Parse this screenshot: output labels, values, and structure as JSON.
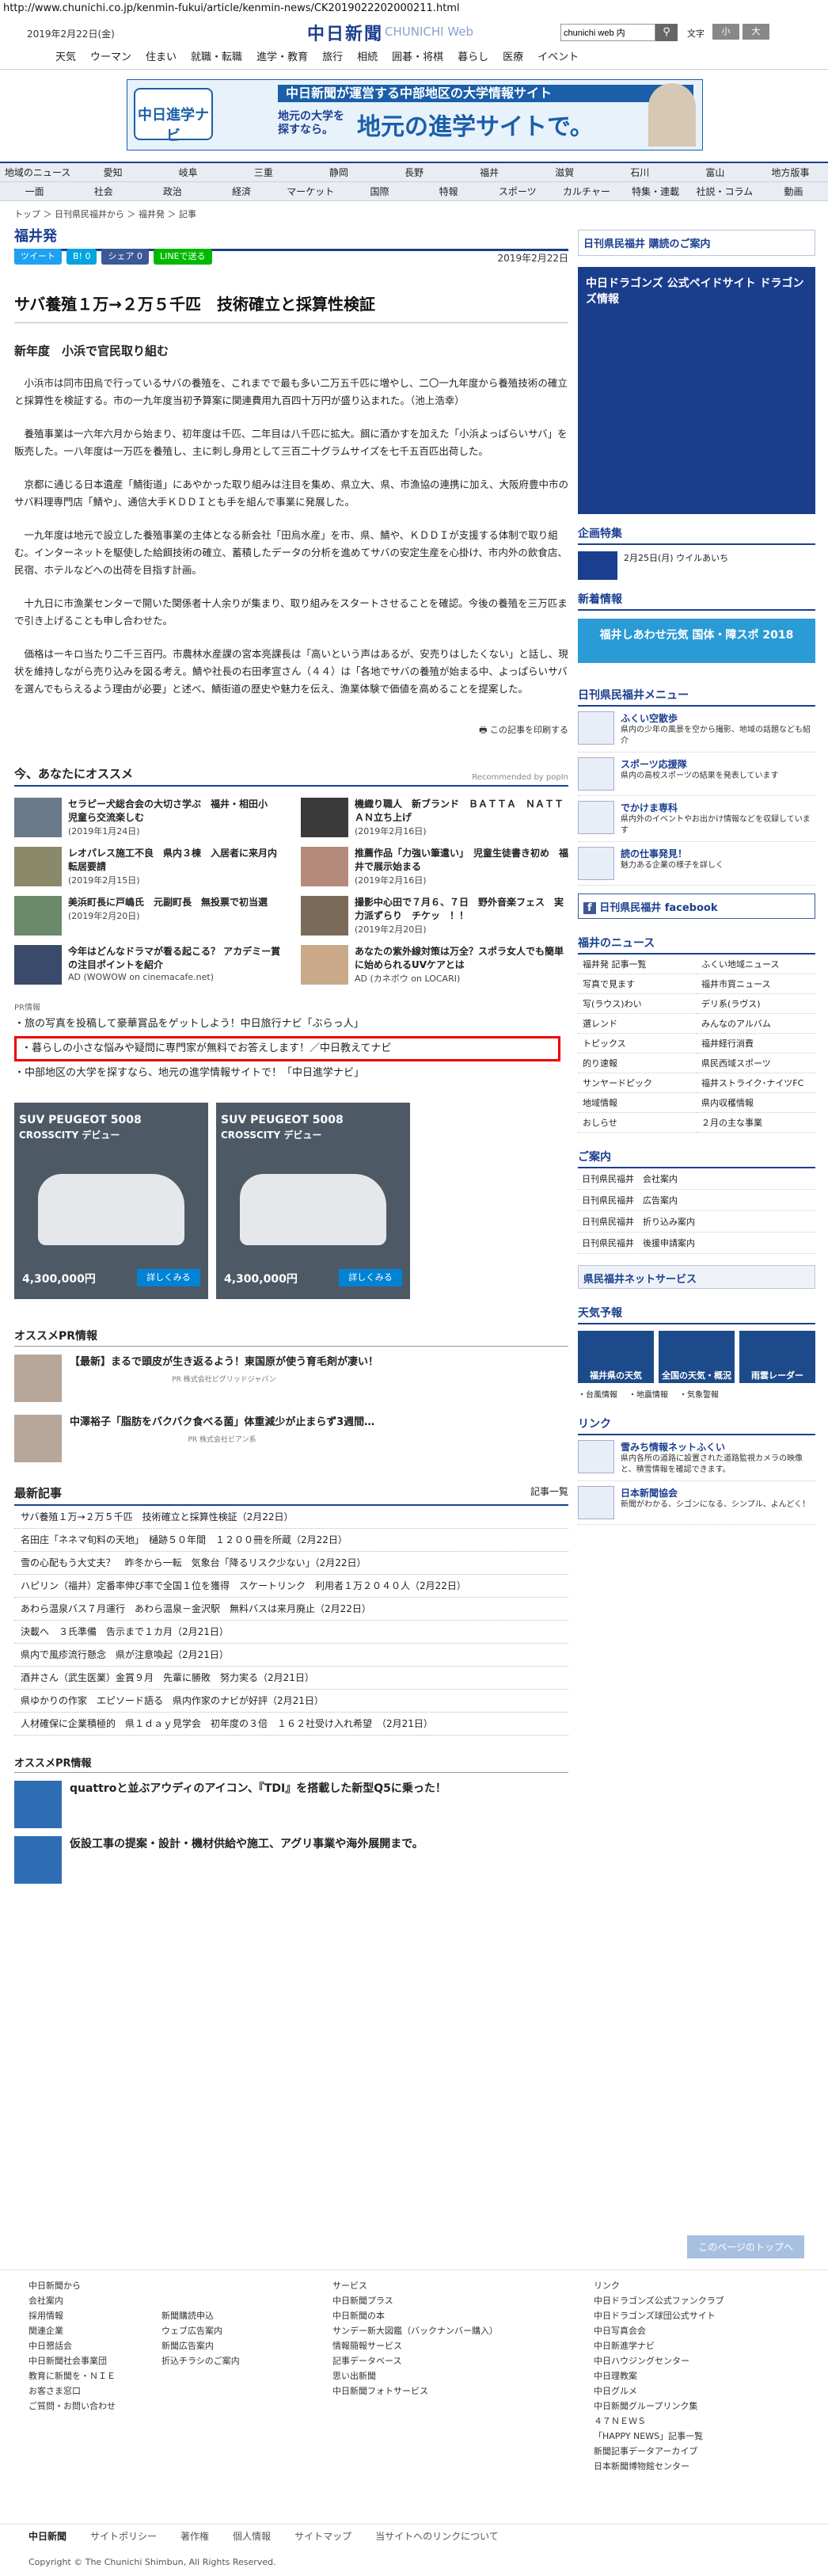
{
  "url": "http://www.chunichi.co.jp/kenmin-fukui/article/kenmin-news/CK2019022202000211.html",
  "header": {
    "date": "2019年2月22日(金)",
    "logo": "中日新聞",
    "logo_en": "CHUNICHI Web",
    "search_placeholder": "chunichi web 内",
    "font_label": "文字",
    "font_small": "小",
    "font_large": "大"
  },
  "top_nav": [
    "天気",
    "ウーマン",
    "住まい",
    "就職・転職",
    "進学・教育",
    "旅行",
    "相続",
    "囲碁・将棋",
    "暮らし",
    "医療",
    "イベント"
  ],
  "banner": {
    "top": "中日新聞が運営する中部地区の大学情報サイト",
    "logo": "中日進学ナビ",
    "sub": "地元の大学を探すなら。",
    "main": "地元の進学サイトで。"
  },
  "sec_nav_1": [
    "地域のニュース",
    "愛知",
    "岐阜",
    "三重",
    "静岡",
    "長野",
    "福井",
    "滋賀",
    "石川",
    "富山",
    "地方版事"
  ],
  "sec_nav_2": [
    "一面",
    "社会",
    "政治",
    "経済",
    "マーケット",
    "国際",
    "特報",
    "スポーツ",
    "カルチャー",
    "特集・連載",
    "社説・コラム",
    "動画"
  ],
  "breadcrumb": "トップ ＞ 日刊県民福井から ＞ 福井発 ＞ 記事",
  "section_title": "福井発",
  "share": [
    "ツイート",
    "B! 0",
    "シェア 0",
    "LINEで送る"
  ],
  "pub_date": "2019年2月22日",
  "headline": "サバ養殖１万→２万５千匹　技術確立と採算性検証",
  "subhead": "新年度　小浜で官民取り組む",
  "paragraphs": [
    "小浜市は同市田烏で行っているサバの養殖を、これまでで最も多い二万五千匹に増やし、二〇一九年度から養殖技術の確立と採算性を検証する。市の一九年度当初予算案に関連費用九百四十万円が盛り込まれた。（池上浩幸）",
    "養殖事業は一六年六月から始まり、初年度は千匹、二年目は八千匹に拡大。餌に酒かすを加えた「小浜よっぱらいサバ」を販売した。一八年度は一万匹を養殖し、主に刺し身用として三百二十グラムサイズを七千五百匹出荷した。",
    "京都に通じる日本遺産「鯖街道」にあやかった取り組みは注目を集め、県立大、県、市漁協の連携に加え、大阪府豊中市のサバ料理専門店「鯖や」、通信大手ＫＤＤＩとも手を組んで事業に発展した。",
    "一九年度は地元で設立した養殖事業の主体となる新会社「田烏水産」を市、県、鯖や、ＫＤＤＩが支援する体制で取り組む。インターネットを駆使した給餌技術の確立、蓄積したデータの分析を進めてサバの安定生産を心掛け、市内外の飲食店、民宿、ホテルなどへの出荷を目指す計画。",
    "十九日に市漁業センターで開いた関係者十人余りが集まり、取り組みをスタートさせることを確認。今後の養殖を三万匹まで引き上げることも申し合わせた。",
    "価格は一キロ当たり二千三百円。市農林水産課の宮本亮課長は「高いという声はあるが、安売りはしたくない」と話し、現状を維持しながら売り込みを図る考え。鯖や社長の右田孝宣さん（４４）は「各地でサバの養殖が始まる中、よっぱらいサバを選んでもらえるよう理由が必要」と述べ、鯖街道の歴史や魅力を伝え、漁業体験で価値を高めることを提案した。"
  ],
  "print_label": "この記事を印刷する",
  "recommend": {
    "title": "今、あなたにオススメ",
    "powered": "Recommended by popIn",
    "items": [
      {
        "t": "セラピー犬総合会の大切さ学ぶ　福井・相田小　児童ら交流楽しむ",
        "d": "(2019年1月24日)"
      },
      {
        "t": "機織り職人　新ブランド　ＢＡＴＴＡ　ＮＡＴＴＡＮ立ち上げ",
        "d": "(2019年2月16日)"
      },
      {
        "t": "レオパレス施工不良　県内３棟　入居者に来月内転居要請",
        "d": "(2019年2月15日)"
      },
      {
        "t": "推薦作品「力強い筆遣い」　児童生徒書き初め　福井で展示始まる",
        "d": "(2019年2月16日)"
      },
      {
        "t": "美浜町長に戸嶋氏　元副町長　無投票で初当選",
        "d": "(2019年2月20日)"
      },
      {
        "t": "撮影中心田で７月６、７日　野外音楽フェス　実力派ずらり　チケッ　！！",
        "d": "(2019年2月20日)"
      },
      {
        "t": "今年はどんなドラマが看る起こる？ アカデミー賞の注目ポイントを紹介",
        "d": "AD (WOWOW on cinemacafe.net)"
      },
      {
        "t": "あなたの紫外線対策は万全？スポラ女人でも簡単に始められるUVケアとは",
        "d": "AD (カネボウ on LOCARI)"
      }
    ]
  },
  "pr_label": "PR情報",
  "pr_links": [
    "・旅の写真を投稿して豪華賞品をゲットしよう！中日旅行ナビ「ぶらっ人」",
    "・暮らしの小さな悩みや疑問に専門家が無料でお答えします！／中日教えてナビ",
    "・中部地区の大学を探すなら、地元の進学情報サイトで！「中日進学ナビ」"
  ],
  "ads": [
    {
      "a1": "SUV PEUGEOT 5008",
      "a2": "CROSSCITY デビュー",
      "price": "4,300,000円",
      "more": "詳しくみる"
    },
    {
      "a1": "SUV PEUGEOT 5008",
      "a2": "CROSSCITY デビュー",
      "price": "4,300,000円",
      "more": "詳しくみる"
    }
  ],
  "pr_info": {
    "title": "オススメPR情報",
    "items": [
      {
        "t": "【最新】まるで頭皮が生き返るよう！東国原が使う育毛剤が凄い！",
        "s": "PR 株式会社ビグリッドジャパン"
      },
      {
        "t": "中澤裕子「脂肪をバクバク食べる菌」体重減少が止まらず3週間…",
        "s": "PR 株式会社ビアン系"
      }
    ]
  },
  "latest": {
    "title": "最新記事",
    "more": "記事一覧",
    "items": [
      "サバ養殖１万→２万５千匹　技術確立と採算性検証（2月22日）",
      "名田庄「ネネマ旬料の天地」　樋跡５０年間　１２００冊を所蔵（2月22日）",
      "雪の心配もう大丈夫？　昨冬から一転　気象台「降るリスク少ない」（2月22日）",
      "ハピリン（福井）定番率伸び率で全国１位を獲得　スケートリンク　利用者１万２０４０人（2月22日）",
      "あわら温泉バス７月運行　あわら温泉－金沢駅　無料バスは来月廃止（2月22日）",
      "決載へ　３氏準備　告示まで１カ月（2月21日）",
      "県内で風疹流行懸念　県が注意喚起（2月21日）",
      "酒井さん（武生医業）金賞９月　先輩に勝敗　努力実る（2月21日）",
      "県ゆかりの作家　エピソード語る　県内作家のナビが好評（2月21日）",
      "人材確保に企業積極的　県１ｄａｙ見学会　初年度の３倍　１６２社受け入れ希望　（2月21日）"
    ]
  },
  "oss2": {
    "title": "オススメPR情報",
    "items": [
      "quattroと並ぶアウディのアイコン、『TDI』を搭載した新型Q5に乗った！",
      "仮設工事の提案・設計・機材供給や施工、アグリ事業や海外展開まで。"
    ]
  },
  "side": {
    "kenmin_ad": "日刊県民福井 購読のご案内",
    "dragons": "中日ドラゴンズ 公式ペイドサイト ドラゴンズ情報",
    "kikaku": "企画特集",
    "kikaku_txt": "2月25日(月) ウイルあいち",
    "shinsho": "新着情報",
    "shinsho_txt": "福井しあわせ元気 国体・障スポ 2018",
    "menu_title": "日刊県民福井メニュー",
    "menu": [
      {
        "t1": "ふくい空散歩",
        "t2": "県内の少年の風景を空から撮影、地域の話題なども紹介"
      },
      {
        "t1": "スポーツ応援隊",
        "t2": "県内の高校スポーツの結果を発表しています"
      },
      {
        "t1": "でかけま専科",
        "t2": "県内外のイベントやお出かけ情報などを収録しています"
      },
      {
        "t1": "読の仕事発見！",
        "t2": "魅力ある企業の様子を詳しく"
      }
    ],
    "fb": "日刊県民福井 facebook",
    "news_title": "福井のニュース",
    "news": [
      "福井発 記事一覧",
      "ふくい地域ニュース",
      "写真で見ます",
      "福井市買ニュース",
      "写(ラウス)わい",
      "デリ系(ラヴス)",
      "選レンド",
      "みんなのアルバム",
      "トピックス",
      "福井経行消費",
      "的り速報",
      "県民西域スポーツ",
      "サンヤードピック",
      "福井ストライク･ナイツFC",
      "地域情報",
      "県内収穫情報",
      "おしらせ",
      "２月の主な事業"
    ],
    "annai_title": "ご案内",
    "annai": [
      "日刊県民福井　会社案内",
      "日刊県民福井　広告案内",
      "日刊県民福井　折り込み案内",
      "日刊県民福井　後援申請案内"
    ],
    "net_service": "県民福井ネットサービス",
    "weather_title": "天気予報",
    "weather": [
      "福井県の天気",
      "全国の天気・概況",
      "雨雲レーダー"
    ],
    "weather_sub": [
      "・台風情報",
      "・地震情報",
      "・気象警報"
    ],
    "link_title": "リンク",
    "links": [
      {
        "t1": "雪みち情報ネットふくい",
        "t2": "県内各所の道路に設置された道路監視カメラの映像と、積雪情報を確認できます。"
      },
      {
        "t1": "日本新聞協会",
        "t2": "新聞がわかる、シゴンになる、シンプル、よんどく！"
      }
    ]
  },
  "footer": {
    "totop": "このページのトップへ",
    "col1": [
      "中日新聞から",
      "会社案内",
      "採用情報",
      "関連企業",
      "中日懇話会",
      "中日新聞社会事業団",
      "教育に新聞を・ＮＩＥ",
      "お客さま窓口",
      "ご質問・お問い合わせ"
    ],
    "col2": [
      "新聞購読申込",
      "ウェブ広告案内",
      "新聞広告案内",
      "折込チラシのご案内"
    ],
    "col3": [
      "サービス",
      "中日新聞プラス",
      "中日新聞の本",
      "サンデー新大図鑑（バックナンバー購入）",
      "情報簡報サービス",
      "記事データベース",
      "思い出新聞",
      "中日新聞フォトサービス"
    ],
    "col4": [
      "リンク",
      "中日ドラゴンズ公式ファンクラブ",
      "中日ドラゴンズ球団公式サイト",
      "中日写真会会",
      "中日新進学ナビ",
      "中日ハウジングセンター",
      "中日理教案",
      "中日グルメ",
      "中日新聞グループリンク集",
      "４７ＮＥＷＳ",
      "「HAPPY NEWS」記事一覧",
      "新聞記事データアーカイブ",
      "日本新聞博物館センター"
    ],
    "bar": [
      "中日新聞",
      "サイトポリシー",
      "著作権",
      "個人情報",
      "サイトマップ",
      "当サイトへのリンクについて"
    ],
    "copyright": "Copyright © The Chunichi Shimbun, All Rights Reserved."
  }
}
